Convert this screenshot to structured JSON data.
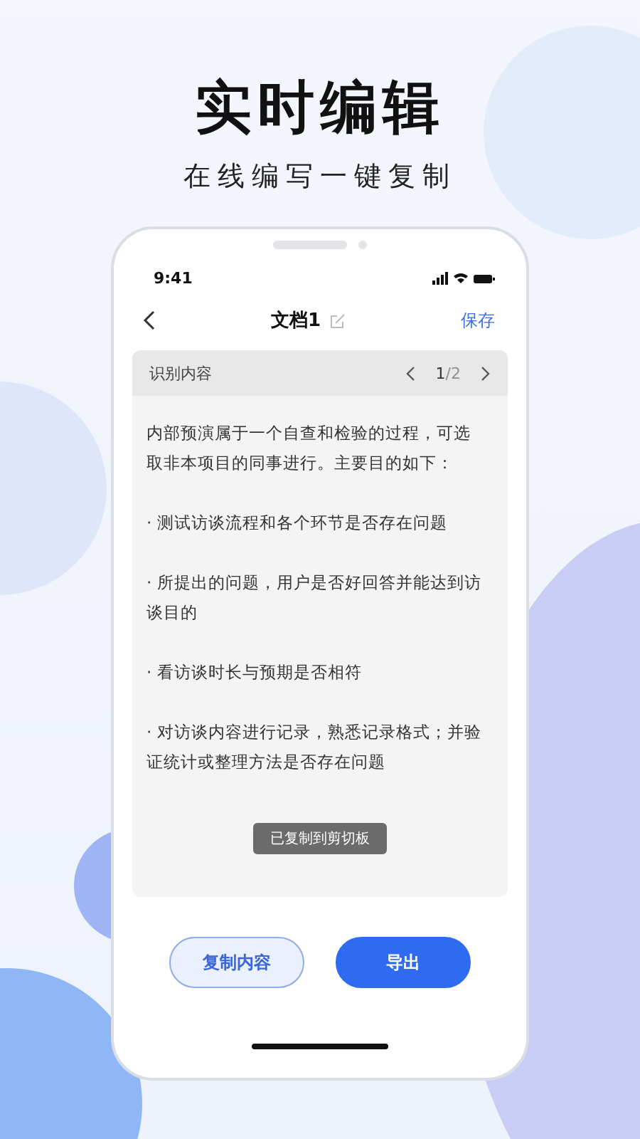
{
  "headline": "实时编辑",
  "subtitle": "在线编写一键复制",
  "status_bar": {
    "time": "9:41"
  },
  "nav": {
    "title": "文档1",
    "action": "保存"
  },
  "card": {
    "label": "识别内容",
    "page_current": "1",
    "page_total": "/2",
    "paragraphs": [
      "内部预演属于一个自查和检验的过程，可选取非本项目的同事进行。主要目的如下：",
      "· 测试访谈流程和各个环节是否存在问题",
      "· 所提出的问题，用户是否好回答并能达到访谈目的",
      "· 看访谈时长与预期是否相符",
      "· 对访谈内容进行记录，熟悉记录格式；并验证统计或整理方法是否存在问题"
    ],
    "toast": "已复制到剪切板"
  },
  "buttons": [
    {
      "label": "复制内容",
      "kind": "secondary"
    },
    {
      "label": "导出",
      "kind": "primary"
    }
  ]
}
